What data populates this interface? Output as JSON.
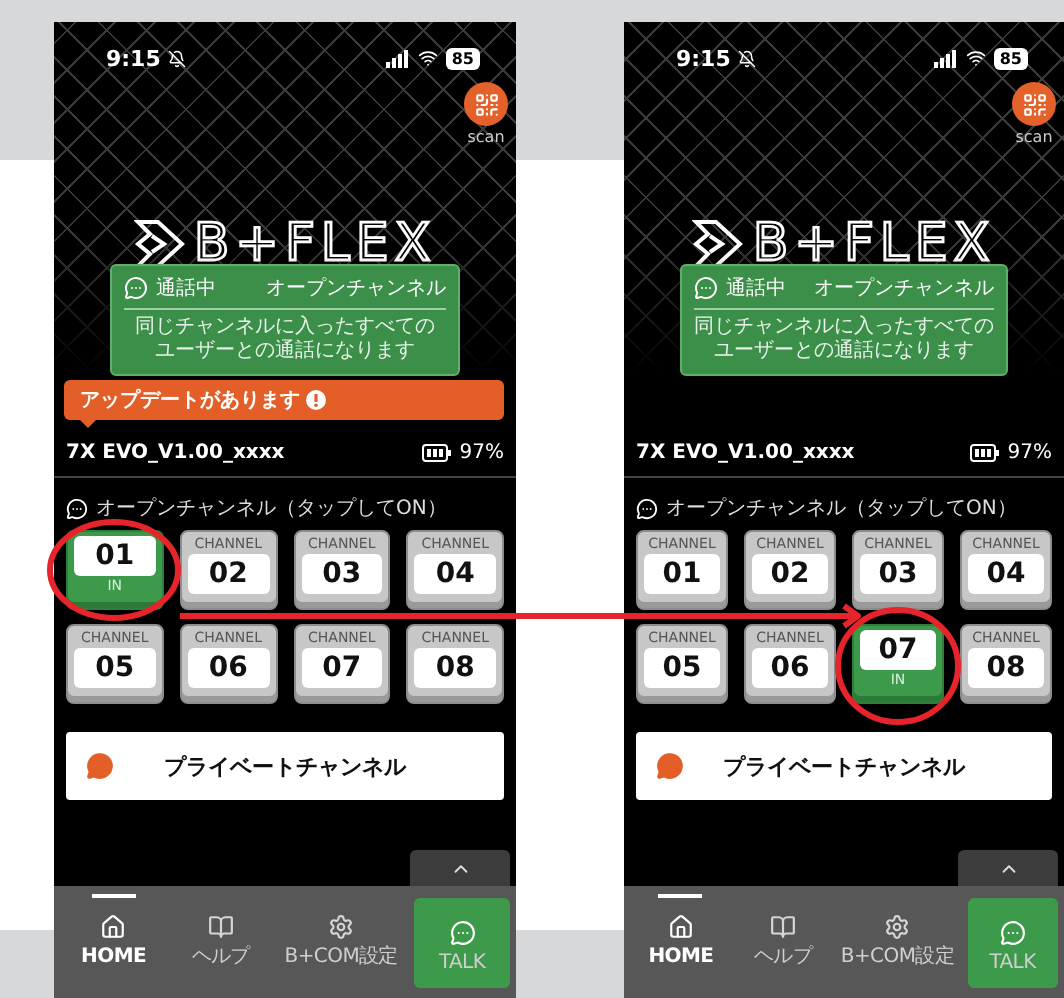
{
  "phones": [
    {
      "status_bar": {
        "time": "9:15",
        "battery": "85"
      },
      "scan_label": "scan",
      "logo_text": "B+FLEX",
      "popup": {
        "title": "通話中",
        "mode": "オープンチャンネル",
        "message": "同じチャンネルに入ったすべてのユーザーとの通話になります"
      },
      "update_banner": "アップデートがあります",
      "device": {
        "name": "7X EVO_V1.00_xxxx",
        "battery": "97%"
      },
      "open_channels": {
        "label": "オープンチャンネル（タップしてON）",
        "channels": [
          {
            "number": "01",
            "status": "IN",
            "selected": true
          },
          {
            "label": "CHANNEL",
            "number": "02",
            "selected": false
          },
          {
            "label": "CHANNEL",
            "number": "03",
            "selected": false
          },
          {
            "label": "CHANNEL",
            "number": "04",
            "selected": false
          },
          {
            "label": "CHANNEL",
            "number": "05",
            "selected": false
          },
          {
            "label": "CHANNEL",
            "number": "06",
            "selected": false
          },
          {
            "label": "CHANNEL",
            "number": "07",
            "selected": false
          },
          {
            "label": "CHANNEL",
            "number": "08",
            "selected": false
          }
        ]
      },
      "private_button": "プライベートチャンネル",
      "nav": [
        {
          "kind": "home",
          "label": "HOME",
          "selected": true
        },
        {
          "kind": "help",
          "label": "ヘルプ",
          "selected": false
        },
        {
          "kind": "settings",
          "label": "B+COM設定",
          "selected": false
        },
        {
          "kind": "talk",
          "label": "TALK",
          "selected": false
        }
      ]
    },
    {
      "status_bar": {
        "time": "9:15",
        "battery": "85"
      },
      "scan_label": "scan",
      "logo_text": "B+FLEX",
      "popup": {
        "title": "通話中",
        "mode": "オープンチャンネル",
        "message": "同じチャンネルに入ったすべてのユーザーとの通話になります"
      },
      "device": {
        "name": "7X EVO_V1.00_xxxx",
        "battery": "97%"
      },
      "open_channels": {
        "label": "オープンチャンネル（タップしてON）",
        "channels": [
          {
            "label": "CHANNEL",
            "number": "01",
            "selected": false
          },
          {
            "label": "CHANNEL",
            "number": "02",
            "selected": false
          },
          {
            "label": "CHANNEL",
            "number": "03",
            "selected": false
          },
          {
            "label": "CHANNEL",
            "number": "04",
            "selected": false
          },
          {
            "label": "CHANNEL",
            "number": "05",
            "selected": false
          },
          {
            "label": "CHANNEL",
            "number": "06",
            "selected": false
          },
          {
            "number": "07",
            "status": "IN",
            "selected": true
          },
          {
            "label": "CHANNEL",
            "number": "08",
            "selected": false
          }
        ]
      },
      "private_button": "プライベートチャンネル",
      "nav": [
        {
          "kind": "home",
          "label": "HOME",
          "selected": true
        },
        {
          "kind": "help",
          "label": "ヘルプ",
          "selected": false
        },
        {
          "kind": "settings",
          "label": "B+COM設定",
          "selected": false
        },
        {
          "kind": "talk",
          "label": "TALK",
          "selected": false
        }
      ]
    }
  ]
}
